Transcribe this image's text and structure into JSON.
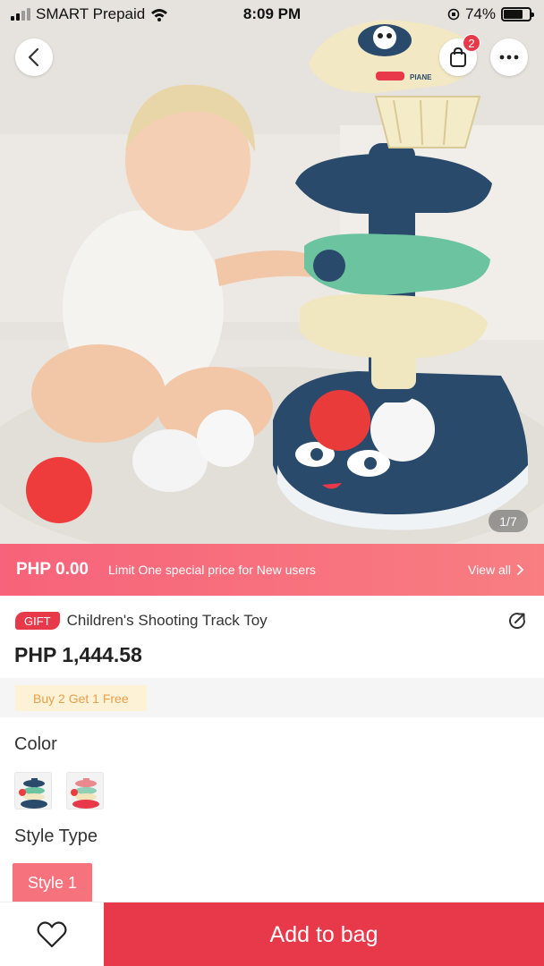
{
  "status_bar": {
    "carrier": "SMART Prepaid",
    "time": "8:09 PM",
    "battery": "74%",
    "battery_level": 0.74,
    "icons": [
      "signal-icon",
      "wifi-icon",
      "orientation-lock-icon",
      "battery-icon"
    ]
  },
  "header": {
    "back_icon": "chevron-left-icon",
    "bag_icon": "shopping-bag-icon",
    "bag_count": "2",
    "more_icon": "more-dots-icon"
  },
  "gallery": {
    "counter": "1/7",
    "product_image_text": "PIANE"
  },
  "promo": {
    "price": "PHP 0.00",
    "text": "Limit One special price for New users",
    "view_all": "View all"
  },
  "product": {
    "gift_badge": "GIFT",
    "title": "Children's Shooting Track Toy",
    "price": "PHP 1,444.58",
    "deal": "Buy 2 Get 1 Free",
    "share_icon": "share-icon"
  },
  "options": {
    "color_label": "Color",
    "style_label": "Style Type",
    "selected_style": "Style 1"
  },
  "bottom_bar": {
    "favorite_icon": "heart-icon",
    "add_to_bag": "Add to bag"
  },
  "colors": {
    "accent": "#e8394a",
    "promo_start": "#f7637a",
    "promo_end": "#f87e82",
    "deal_bg": "#fdf1d6",
    "deal_text": "#e9a04b",
    "style_chip": "#f6727c",
    "toy_navy": "#2a4a6b",
    "toy_green": "#6cc3a0",
    "toy_cream": "#f0e6c0"
  }
}
